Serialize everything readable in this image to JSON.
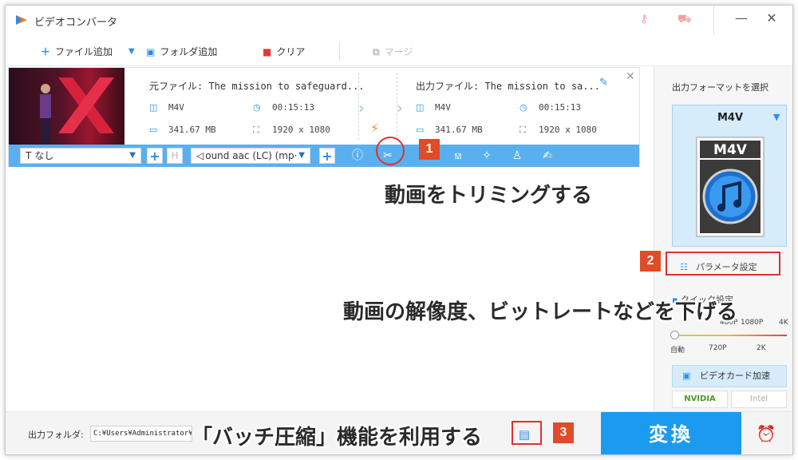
{
  "window": {
    "title": "ビデオコンバータ"
  },
  "toolbar": {
    "add_file": "ファイル追加",
    "add_folder": "フォルダ追加",
    "clear": "クリア",
    "merge": "マージ"
  },
  "task": {
    "source_label": "元ファイル: The mission to safeguard...",
    "output_label": "出力ファイル: The mission to sa...",
    "source": {
      "format": "M4V",
      "duration": "00:15:13",
      "size": "341.67 MB",
      "resolution": "1920 x 1080"
    },
    "output": {
      "format": "M4V",
      "duration": "00:15:13",
      "size": "341.67 MB",
      "resolution": "1920 x 1080"
    }
  },
  "editbar": {
    "subtitle_value": "なし",
    "audio_value": "ound aac (LC) (mp·"
  },
  "annotations": {
    "badge1": "1",
    "badge2": "2",
    "badge3": "3",
    "caption1": "動画をトリミングする",
    "caption2": "動画の解像度、ビットレートなどを下げる",
    "caption3": "「バッチ圧縮」機能を利用する"
  },
  "right_panel": {
    "title": "出力フォーマットを選択",
    "format": "M4V",
    "format_icon_text": "M4V",
    "param_button": "パラメータ設定",
    "quick_settings": "クイック設定",
    "slider_labels_top": [
      "480P",
      "1080P",
      "4K"
    ],
    "slider_labels_bottom": [
      "自動",
      "720P",
      "2K"
    ],
    "slider_level": 0,
    "gpu_button": "ビデオカード加速",
    "vendor_nvidia": "NVIDIA",
    "vendor_intel": "Intel"
  },
  "bottom": {
    "output_folder_label": "出力フォルダ:",
    "output_path": "C:¥Users¥Administrator¥Deskt",
    "convert_button": "変換"
  },
  "colors": {
    "accent": "#1a9bf0",
    "bluebar": "#5ab0ee",
    "annotation_red": "#e03030",
    "badge_orange": "#e04b28"
  }
}
